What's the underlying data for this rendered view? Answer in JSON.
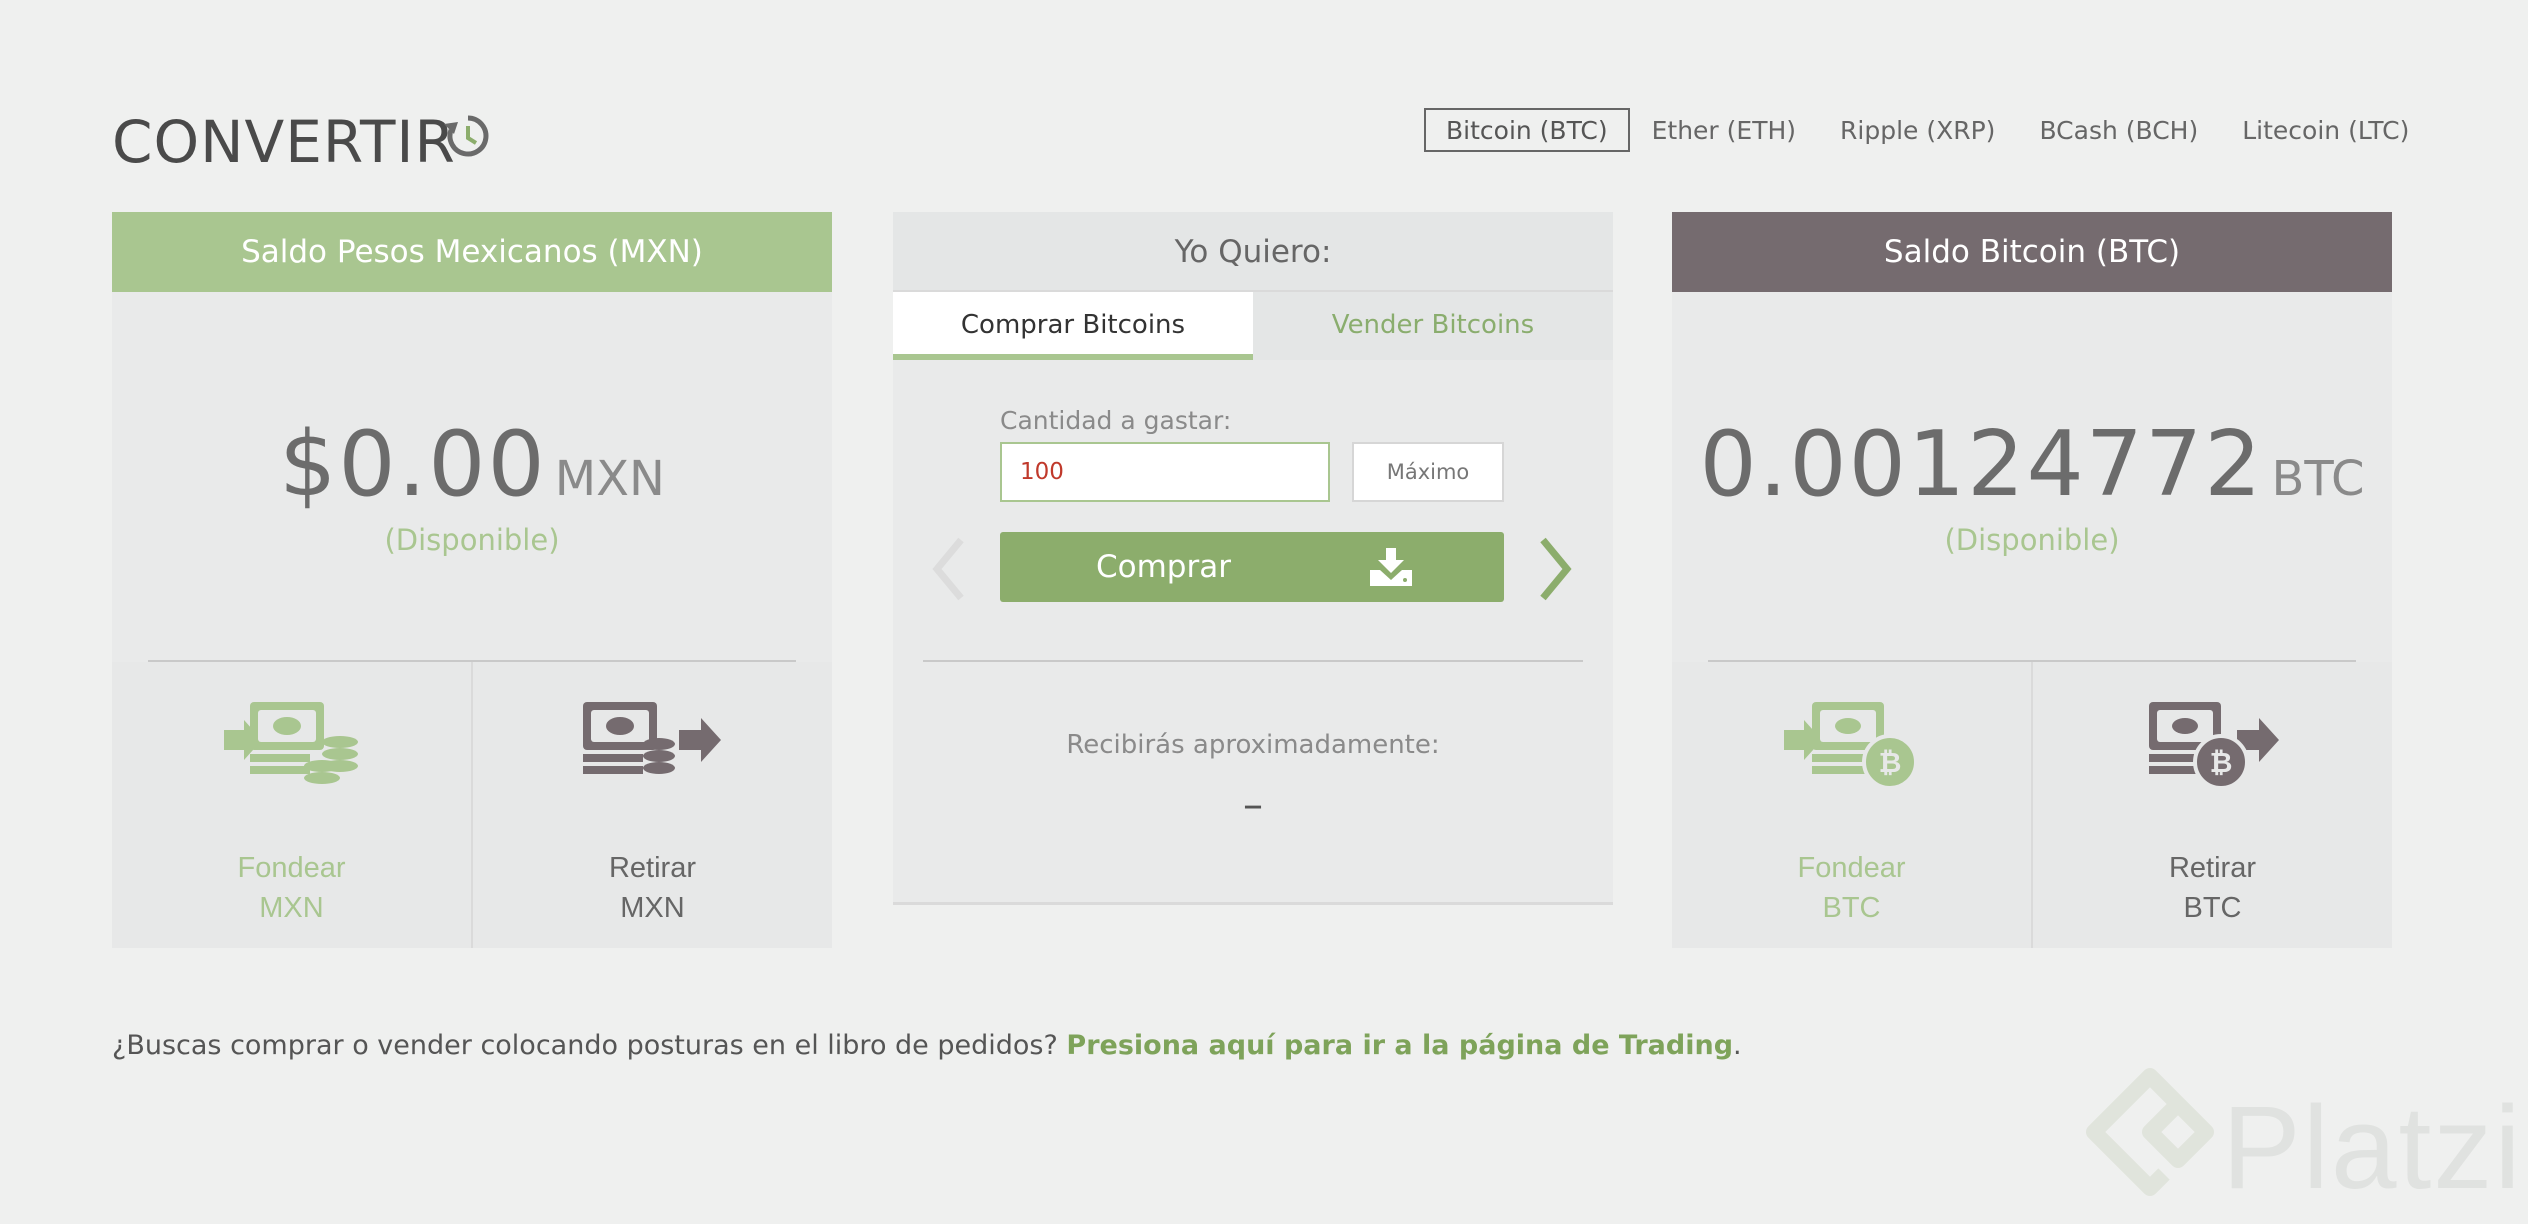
{
  "header": {
    "title": "CONVERTIR",
    "coin_tabs": [
      {
        "label": "Bitcoin (BTC)",
        "active": true
      },
      {
        "label": "Ether (ETH)",
        "active": false
      },
      {
        "label": "Ripple (XRP)",
        "active": false
      },
      {
        "label": "BCash (BCH)",
        "active": false
      },
      {
        "label": "Litecoin (LTC)",
        "active": false
      }
    ]
  },
  "left_panel": {
    "title": "Saldo Pesos Mexicanos (MXN)",
    "amount": "$0.00",
    "unit": "MXN",
    "status": "(Disponible)",
    "actions": [
      {
        "line1": "Fondear",
        "line2": "MXN",
        "icon": "fund-mxn-icon"
      },
      {
        "line1": "Retirar",
        "line2": "MXN",
        "icon": "withdraw-mxn-icon"
      }
    ]
  },
  "middle_panel": {
    "title": "Yo Quiero:",
    "tabs": [
      "Comprar Bitcoins",
      "Vender Bitcoins"
    ],
    "field_label": "Cantidad a gastar:",
    "amount_value": "100",
    "max_label": "Máximo",
    "buy_label": "Comprar",
    "receive_label": "Recibirás aproximadamente:",
    "receive_value": "–"
  },
  "right_panel": {
    "title": "Saldo Bitcoin (BTC)",
    "amount": "0.00124772",
    "unit": "BTC",
    "status": "(Disponible)",
    "actions": [
      {
        "line1": "Fondear",
        "line2": "BTC",
        "icon": "fund-btc-icon"
      },
      {
        "line1": "Retirar",
        "line2": "BTC",
        "icon": "withdraw-btc-icon"
      }
    ]
  },
  "footer": {
    "text": "¿Buscas comprar o vender colocando posturas en el libro de pedidos? ",
    "link": "Presiona aquí para ir a la página de Trading",
    "end": "."
  },
  "watermark": {
    "text": "Platzi"
  },
  "colors": {
    "accent_green": "#a9c690",
    "button_green": "#8cad6c",
    "btc_header": "#756b6f",
    "background": "#eff0ef"
  }
}
